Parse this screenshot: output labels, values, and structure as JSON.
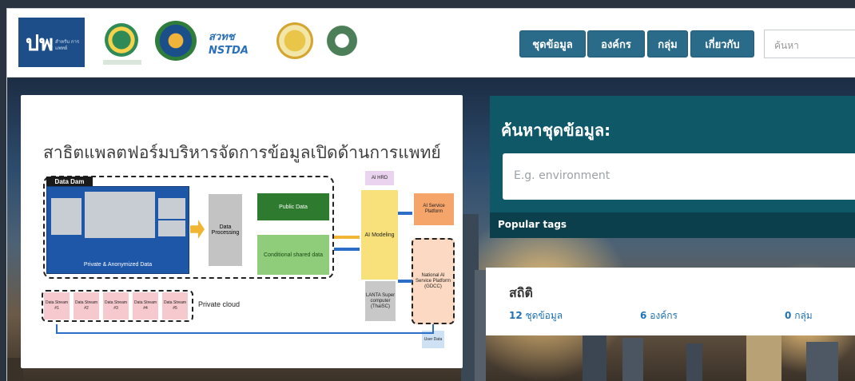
{
  "header": {
    "brand": {
      "mark": "ปพ",
      "tagline": "สำหรับ การแพทย์"
    },
    "partners": [
      "partner-logo-1",
      "partner-logo-2",
      "partner-logo-3",
      "partner-logo-4",
      "partner-logo-5"
    ],
    "partner_text": "สวทช NSTDA",
    "nav": [
      {
        "label": "ชุดข้อมูล"
      },
      {
        "label": "องค์กร"
      },
      {
        "label": "กลุ่ม"
      },
      {
        "label": "เกี่ยวกับ"
      }
    ],
    "search_placeholder": "ค้นหา"
  },
  "info": {
    "title": "สาธิตแพลตฟอร์มบริหารจัดการข้อมูลเปิดด้านการแพทย์",
    "diagram": {
      "data_dam": "Data Dam",
      "private_anon": "Private & Anonymized Data",
      "processing": "Data Processing",
      "public": "Public Data",
      "conditional": "Conditional shared data",
      "ai_hrd": "AI HRD",
      "ai_modeling": "AI Modeling",
      "lanta": "LANTA Super computer (ThaiSC)",
      "ai_service": "AI Service Platform",
      "national": "National AI Service Platform (GDCC)",
      "private_cloud": "Private cloud",
      "user_data": "User Data",
      "streams": [
        "Data Stream #1",
        "Data Stream #2",
        "Data Stream #3",
        "Data Stream #4",
        "Data Stream #5"
      ]
    }
  },
  "search": {
    "heading": "ค้นหาชุดข้อมูล:",
    "placeholder": "E.g. environment",
    "popular_tags": "Popular tags"
  },
  "stats": {
    "title": "สถิติ",
    "items": [
      {
        "count": "12",
        "label": "ชุดข้อมูล"
      },
      {
        "count": "6",
        "label": "องค์กร"
      },
      {
        "count": "0",
        "label": "กลุ่ม"
      }
    ]
  },
  "colors": {
    "nav_button": "#2b6b8a",
    "search_panel": "#0f5868",
    "brand": "#1d4e8a",
    "link": "#1f72b5"
  }
}
